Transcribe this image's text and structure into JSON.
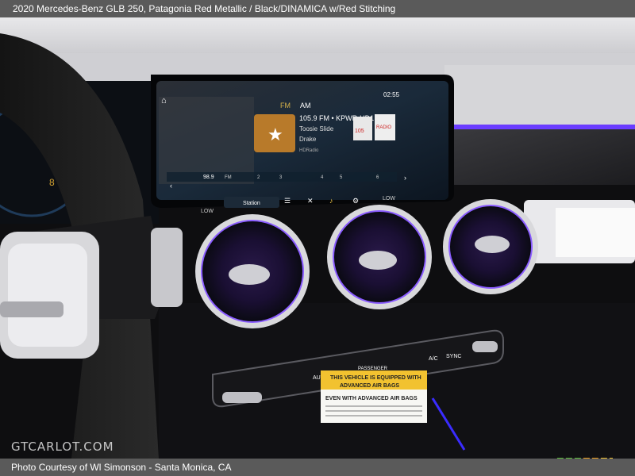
{
  "header": {
    "title": "2020 Mercedes-Benz GLB 250,  Patagonia Red Metallic / Black/DINAMICA w/Red Stitching"
  },
  "footer": {
    "credit": "Photo Courtesy of Wl Simonson - Santa Monica, CA"
  },
  "watermark": {
    "text": "GTCARLOT.COM"
  },
  "screen": {
    "band": "FM",
    "band2": "AM",
    "time": "02:55",
    "station": "105.9 FM • KPWR-HD1",
    "song": "Toosie Slide",
    "artist": "Drake",
    "source_logo": "HDRadio",
    "badge1": "105",
    "badge2": "RADIO",
    "frequency": "98.9",
    "freq_unit": "FM",
    "presets": [
      "2",
      "3",
      "4",
      "5",
      "6"
    ],
    "station_button": "Station",
    "low_left": "LOW",
    "low_right": "LOW"
  },
  "climate": {
    "auto_label": "AUTO",
    "passenger_label": "PASSENGER",
    "ac_label": "A/C",
    "sync_label": "SYNC"
  },
  "sticker": {
    "line1": "THIS VEHICLE IS EQUIPPED WITH",
    "line2": "ADVANCED AIR BAGS",
    "line3": "EVEN WITH ADVANCED AIR BAGS"
  },
  "colors": {
    "ambient": "#6a3cff",
    "vent_glow": "#8a5cff",
    "sticker_yellow": "#f2c230"
  }
}
